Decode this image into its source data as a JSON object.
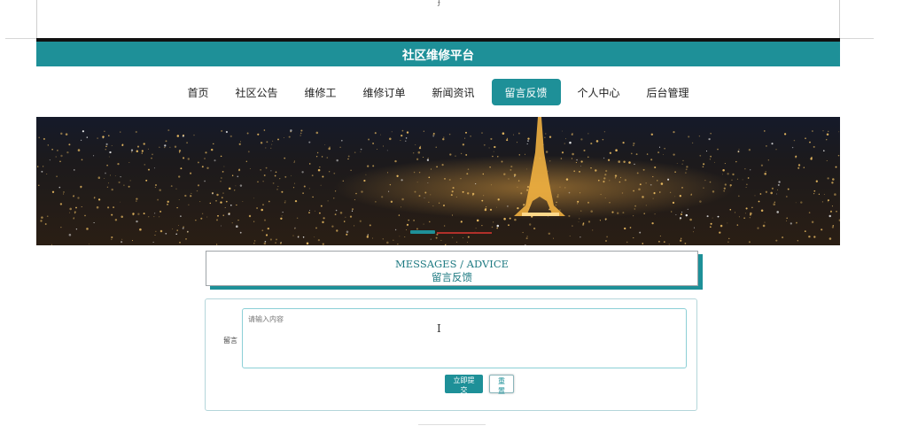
{
  "header": {
    "title": "社区维修平台"
  },
  "nav": {
    "items": [
      {
        "label": "首页",
        "active": false
      },
      {
        "label": "社区公告",
        "active": false
      },
      {
        "label": "维修工",
        "active": false
      },
      {
        "label": "维修订单",
        "active": false
      },
      {
        "label": "新闻资讯",
        "active": false
      },
      {
        "label": "留言反馈",
        "active": true
      },
      {
        "label": "个人中心",
        "active": false
      },
      {
        "label": "后台管理",
        "active": false
      }
    ]
  },
  "page_title": {
    "en": "MESSAGES / ADVICE",
    "cn": "留言反馈"
  },
  "form": {
    "label": "留言",
    "placeholder": "请输入内容",
    "submit_label": "立即提交",
    "reset_label": "重置"
  },
  "colors": {
    "accent": "#1e9098",
    "banner_sky": "#0b0c14"
  }
}
